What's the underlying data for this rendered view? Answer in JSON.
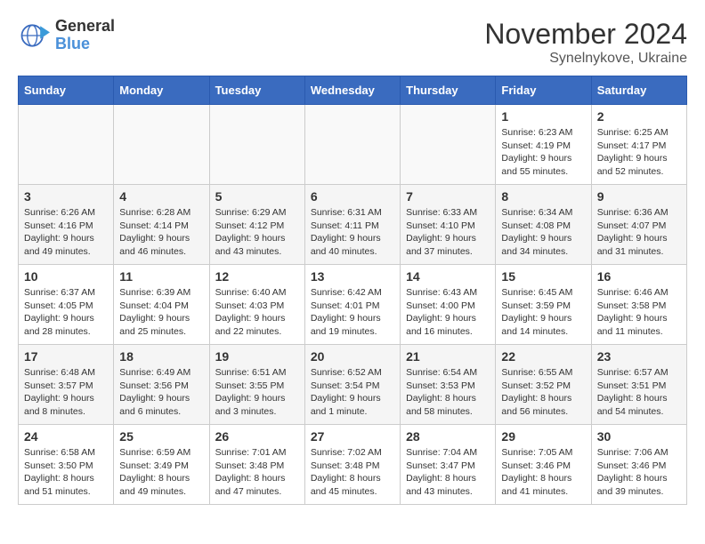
{
  "logo": {
    "general": "General",
    "blue": "Blue"
  },
  "title": {
    "month_year": "November 2024",
    "location": "Synelnykove, Ukraine"
  },
  "weekdays": [
    "Sunday",
    "Monday",
    "Tuesday",
    "Wednesday",
    "Thursday",
    "Friday",
    "Saturday"
  ],
  "weeks": [
    [
      {
        "day": "",
        "info": ""
      },
      {
        "day": "",
        "info": ""
      },
      {
        "day": "",
        "info": ""
      },
      {
        "day": "",
        "info": ""
      },
      {
        "day": "",
        "info": ""
      },
      {
        "day": "1",
        "info": "Sunrise: 6:23 AM\nSunset: 4:19 PM\nDaylight: 9 hours and 55 minutes."
      },
      {
        "day": "2",
        "info": "Sunrise: 6:25 AM\nSunset: 4:17 PM\nDaylight: 9 hours and 52 minutes."
      }
    ],
    [
      {
        "day": "3",
        "info": "Sunrise: 6:26 AM\nSunset: 4:16 PM\nDaylight: 9 hours and 49 minutes."
      },
      {
        "day": "4",
        "info": "Sunrise: 6:28 AM\nSunset: 4:14 PM\nDaylight: 9 hours and 46 minutes."
      },
      {
        "day": "5",
        "info": "Sunrise: 6:29 AM\nSunset: 4:12 PM\nDaylight: 9 hours and 43 minutes."
      },
      {
        "day": "6",
        "info": "Sunrise: 6:31 AM\nSunset: 4:11 PM\nDaylight: 9 hours and 40 minutes."
      },
      {
        "day": "7",
        "info": "Sunrise: 6:33 AM\nSunset: 4:10 PM\nDaylight: 9 hours and 37 minutes."
      },
      {
        "day": "8",
        "info": "Sunrise: 6:34 AM\nSunset: 4:08 PM\nDaylight: 9 hours and 34 minutes."
      },
      {
        "day": "9",
        "info": "Sunrise: 6:36 AM\nSunset: 4:07 PM\nDaylight: 9 hours and 31 minutes."
      }
    ],
    [
      {
        "day": "10",
        "info": "Sunrise: 6:37 AM\nSunset: 4:05 PM\nDaylight: 9 hours and 28 minutes."
      },
      {
        "day": "11",
        "info": "Sunrise: 6:39 AM\nSunset: 4:04 PM\nDaylight: 9 hours and 25 minutes."
      },
      {
        "day": "12",
        "info": "Sunrise: 6:40 AM\nSunset: 4:03 PM\nDaylight: 9 hours and 22 minutes."
      },
      {
        "day": "13",
        "info": "Sunrise: 6:42 AM\nSunset: 4:01 PM\nDaylight: 9 hours and 19 minutes."
      },
      {
        "day": "14",
        "info": "Sunrise: 6:43 AM\nSunset: 4:00 PM\nDaylight: 9 hours and 16 minutes."
      },
      {
        "day": "15",
        "info": "Sunrise: 6:45 AM\nSunset: 3:59 PM\nDaylight: 9 hours and 14 minutes."
      },
      {
        "day": "16",
        "info": "Sunrise: 6:46 AM\nSunset: 3:58 PM\nDaylight: 9 hours and 11 minutes."
      }
    ],
    [
      {
        "day": "17",
        "info": "Sunrise: 6:48 AM\nSunset: 3:57 PM\nDaylight: 9 hours and 8 minutes."
      },
      {
        "day": "18",
        "info": "Sunrise: 6:49 AM\nSunset: 3:56 PM\nDaylight: 9 hours and 6 minutes."
      },
      {
        "day": "19",
        "info": "Sunrise: 6:51 AM\nSunset: 3:55 PM\nDaylight: 9 hours and 3 minutes."
      },
      {
        "day": "20",
        "info": "Sunrise: 6:52 AM\nSunset: 3:54 PM\nDaylight: 9 hours and 1 minute."
      },
      {
        "day": "21",
        "info": "Sunrise: 6:54 AM\nSunset: 3:53 PM\nDaylight: 8 hours and 58 minutes."
      },
      {
        "day": "22",
        "info": "Sunrise: 6:55 AM\nSunset: 3:52 PM\nDaylight: 8 hours and 56 minutes."
      },
      {
        "day": "23",
        "info": "Sunrise: 6:57 AM\nSunset: 3:51 PM\nDaylight: 8 hours and 54 minutes."
      }
    ],
    [
      {
        "day": "24",
        "info": "Sunrise: 6:58 AM\nSunset: 3:50 PM\nDaylight: 8 hours and 51 minutes."
      },
      {
        "day": "25",
        "info": "Sunrise: 6:59 AM\nSunset: 3:49 PM\nDaylight: 8 hours and 49 minutes."
      },
      {
        "day": "26",
        "info": "Sunrise: 7:01 AM\nSunset: 3:48 PM\nDaylight: 8 hours and 47 minutes."
      },
      {
        "day": "27",
        "info": "Sunrise: 7:02 AM\nSunset: 3:48 PM\nDaylight: 8 hours and 45 minutes."
      },
      {
        "day": "28",
        "info": "Sunrise: 7:04 AM\nSunset: 3:47 PM\nDaylight: 8 hours and 43 minutes."
      },
      {
        "day": "29",
        "info": "Sunrise: 7:05 AM\nSunset: 3:46 PM\nDaylight: 8 hours and 41 minutes."
      },
      {
        "day": "30",
        "info": "Sunrise: 7:06 AM\nSunset: 3:46 PM\nDaylight: 8 hours and 39 minutes."
      }
    ]
  ]
}
